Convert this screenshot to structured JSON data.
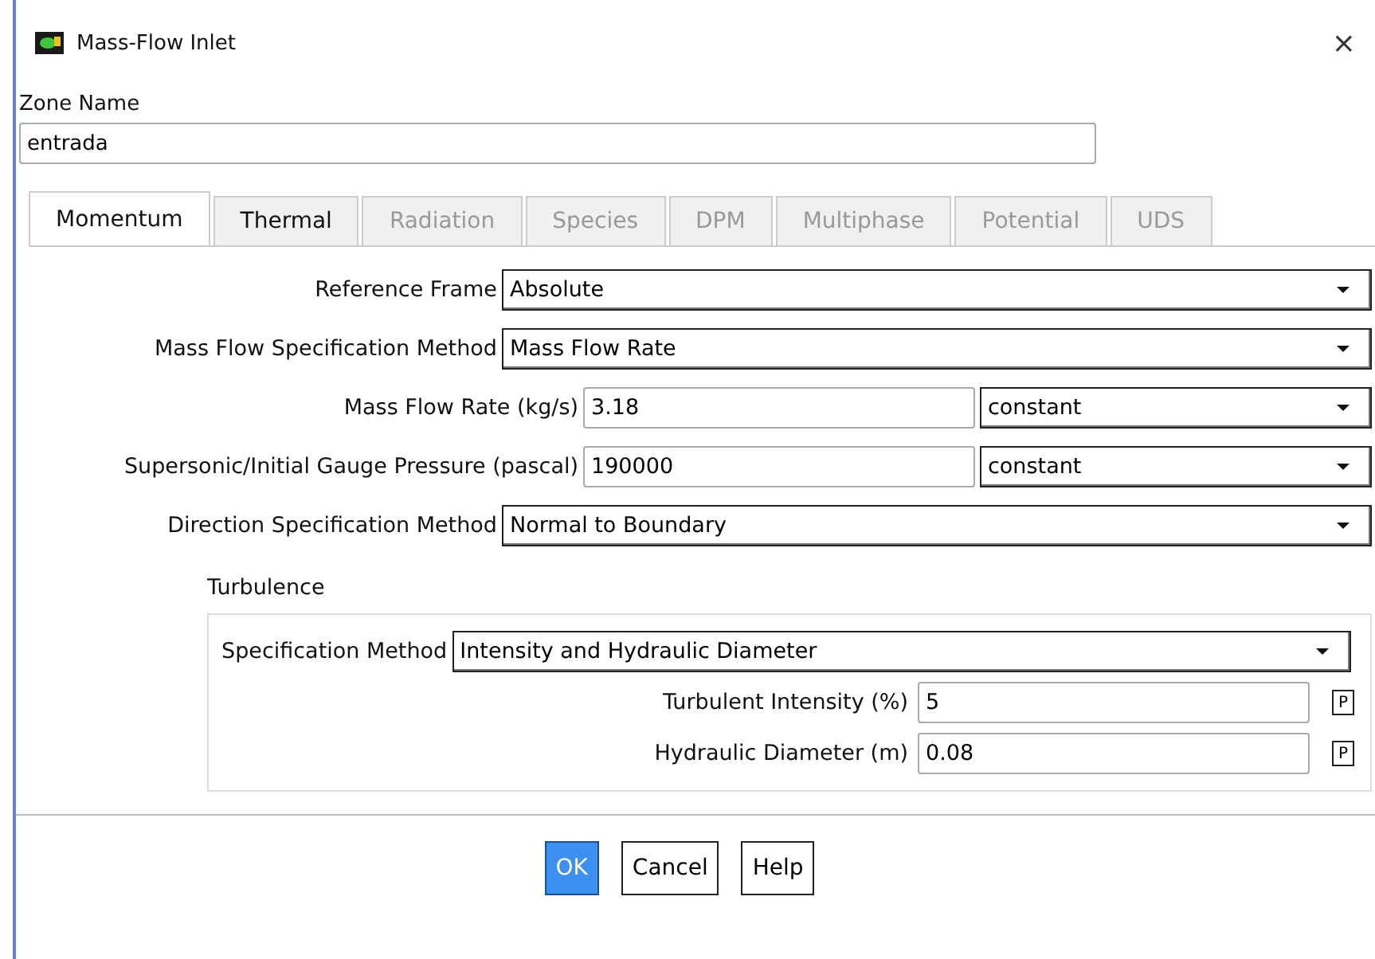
{
  "window": {
    "title": "Mass-Flow Inlet",
    "close": "×"
  },
  "zone": {
    "label": "Zone Name",
    "value": "entrada"
  },
  "tabs": [
    {
      "label": "Momentum",
      "selected": true,
      "disabled": false
    },
    {
      "label": "Thermal",
      "selected": false,
      "disabled": false
    },
    {
      "label": "Radiation",
      "selected": false,
      "disabled": true
    },
    {
      "label": "Species",
      "selected": false,
      "disabled": true
    },
    {
      "label": "DPM",
      "selected": false,
      "disabled": true
    },
    {
      "label": "Multiphase",
      "selected": false,
      "disabled": true
    },
    {
      "label": "Potential",
      "selected": false,
      "disabled": true
    },
    {
      "label": "UDS",
      "selected": false,
      "disabled": true
    }
  ],
  "fields": [
    {
      "kind": "dropdown",
      "label": "Reference Frame",
      "value": "Absolute"
    },
    {
      "kind": "dropdown",
      "label": "Mass Flow Specification Method",
      "value": "Mass Flow Rate"
    },
    {
      "kind": "input_dropdown",
      "label": "Mass Flow Rate (kg/s)",
      "value": "3.18",
      "option": "constant"
    },
    {
      "kind": "input_dropdown",
      "label": "Supersonic/Initial Gauge Pressure (pascal)",
      "value": "190000",
      "option": "constant"
    },
    {
      "kind": "dropdown",
      "label": "Direction Specification Method",
      "value": "Normal to Boundary"
    }
  ],
  "turbulence": {
    "title": "Turbulence",
    "method_label": "Specification Method",
    "method": "Intensity and Hydraulic Diameter",
    "params": [
      {
        "label": "Turbulent Intensity (%)",
        "value": "5",
        "param_button": "P"
      },
      {
        "label": "Hydraulic Diameter (m)",
        "value": "0.08",
        "param_button": "P"
      }
    ]
  },
  "buttons": [
    {
      "label": "OK",
      "selected": true
    },
    {
      "label": "Cancel",
      "selected": false
    },
    {
      "label": "Help",
      "selected": false
    }
  ]
}
